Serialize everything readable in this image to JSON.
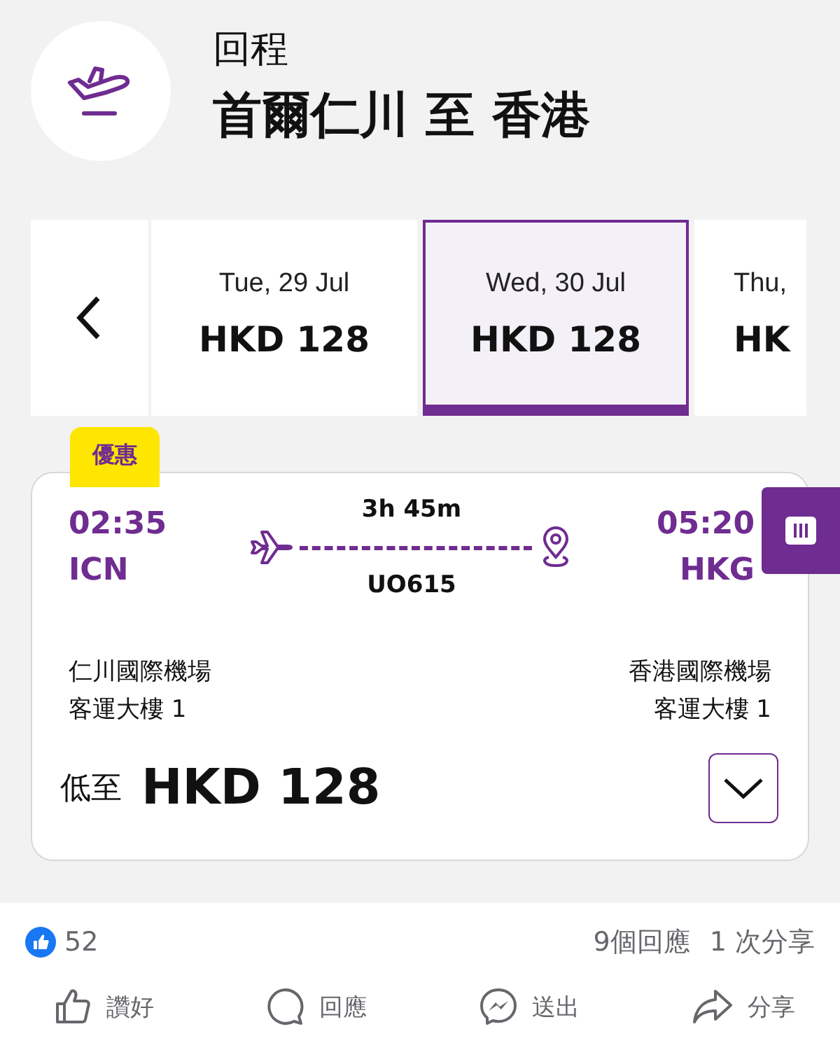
{
  "header": {
    "subtitle": "回程",
    "title": "首爾仁川 至 香港"
  },
  "date_tabs": [
    {
      "date": "Tue, 29 Jul",
      "price": "HKD 128",
      "selected": false
    },
    {
      "date": "Wed, 30 Jul",
      "price": "HKD 128",
      "selected": true
    },
    {
      "date": "Thu,",
      "price": "HK",
      "selected": false
    }
  ],
  "flight": {
    "badge": "優惠",
    "depart_time": "02:35",
    "depart_code": "ICN",
    "duration": "3h 45m",
    "flight_no": "UO615",
    "arrive_time": "05:20",
    "arrive_code": "HKG",
    "depart_airport": "仁川國際機場",
    "depart_terminal": "客運大樓 1",
    "arrive_airport": "香港國際機場",
    "arrive_terminal": "客運大樓 1",
    "price_prefix": "低至",
    "price": "HKD 128",
    "expanded": false
  },
  "social": {
    "likes": "52",
    "comments": "9個回應",
    "shares": "1 次分享",
    "actions": [
      {
        "kind": "like",
        "label": "讚好"
      },
      {
        "kind": "comment",
        "label": "回應"
      },
      {
        "kind": "send",
        "label": "送出"
      },
      {
        "kind": "share",
        "label": "分享"
      }
    ]
  }
}
